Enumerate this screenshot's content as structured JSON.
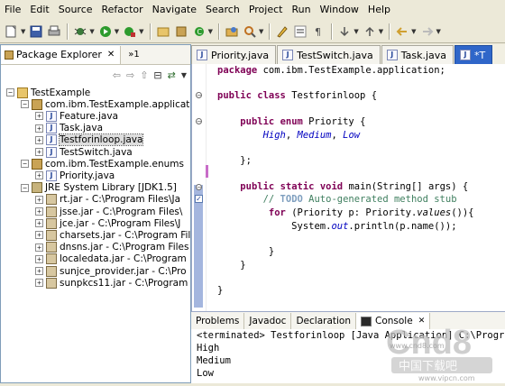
{
  "menu": [
    "File",
    "Edit",
    "Source",
    "Refactor",
    "Navigate",
    "Search",
    "Project",
    "Run",
    "Window",
    "Help"
  ],
  "explorer": {
    "title": "Package Explorer",
    "extra_tab": "»1",
    "tree": [
      {
        "label": "TestExample",
        "icon": "project-icon",
        "expander": "-",
        "indent": 0
      },
      {
        "label": "com.ibm.TestExample.application",
        "icon": "package-icon",
        "expander": "-",
        "indent": 1
      },
      {
        "label": "Feature.java",
        "icon": "java-file-icon",
        "expander": "+",
        "indent": 2
      },
      {
        "label": "Task.java",
        "icon": "java-file-icon",
        "expander": "+",
        "indent": 2
      },
      {
        "label": "Testforinloop.java",
        "icon": "java-file-icon",
        "expander": "+",
        "indent": 2,
        "selected": true
      },
      {
        "label": "TestSwitch.java",
        "icon": "java-file-icon",
        "expander": "+",
        "indent": 2
      },
      {
        "label": "com.ibm.TestExample.enums",
        "icon": "package-icon",
        "expander": "-",
        "indent": 1
      },
      {
        "label": "Priority.java",
        "icon": "java-file-icon",
        "expander": "+",
        "indent": 2
      },
      {
        "label": "JRE System Library [JDK1.5]",
        "icon": "library-icon",
        "expander": "-",
        "indent": 1
      },
      {
        "label": "rt.jar - C:\\Program Files\\Ja",
        "icon": "jar-icon",
        "expander": "+",
        "indent": 2
      },
      {
        "label": "jsse.jar - C:\\Program Files\\",
        "icon": "jar-icon",
        "expander": "+",
        "indent": 2
      },
      {
        "label": "jce.jar - C:\\Program Files\\J",
        "icon": "jar-icon",
        "expander": "+",
        "indent": 2
      },
      {
        "label": "charsets.jar - C:\\Program Fil",
        "icon": "jar-icon",
        "expander": "+",
        "indent": 2
      },
      {
        "label": "dnsns.jar - C:\\Program Files",
        "icon": "jar-icon",
        "expander": "+",
        "indent": 2
      },
      {
        "label": "localedata.jar - C:\\Program",
        "icon": "jar-icon",
        "expander": "+",
        "indent": 2
      },
      {
        "label": "sunjce_provider.jar - C:\\Pro",
        "icon": "jar-icon",
        "expander": "+",
        "indent": 2
      },
      {
        "label": "sunpkcs11.jar - C:\\Program F",
        "icon": "jar-icon",
        "expander": "+",
        "indent": 2
      }
    ]
  },
  "editor": {
    "tabs": [
      {
        "label": "Priority.java",
        "active": false
      },
      {
        "label": "TestSwitch.java",
        "active": false
      },
      {
        "label": "Task.java",
        "active": false
      },
      {
        "label": "*T",
        "active": true
      }
    ]
  },
  "console": {
    "tabs": [
      "Problems",
      "Javadoc",
      "Declaration",
      "Console"
    ],
    "active_tab": "Console",
    "header": "<terminated> Testforinloop [Java Application] C:\\Program Files\\Java",
    "output": [
      "High",
      "Medium",
      "Low"
    ]
  },
  "watermark": {
    "brand": "Cnd8",
    "cn": "中国下载吧",
    "url": "www.cnd8.com",
    "url2": "www.vipcn.com"
  },
  "colors": {
    "keyword": "#7f0055",
    "constant": "#0000c0",
    "comment": "#3f7f5f",
    "selection": "#2f66c9"
  }
}
